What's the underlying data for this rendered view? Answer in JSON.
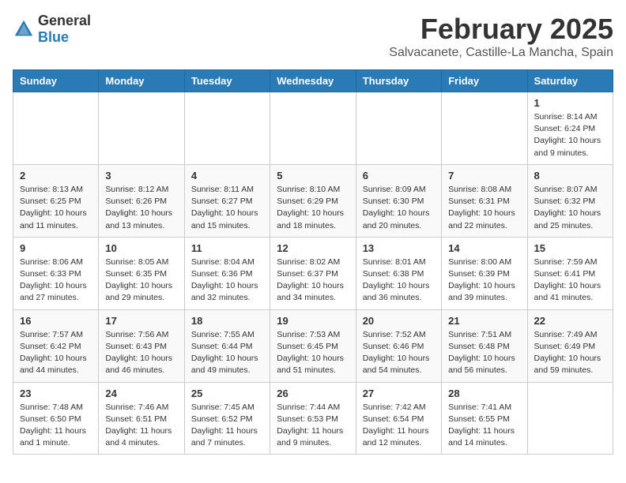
{
  "header": {
    "logo_general": "General",
    "logo_blue": "Blue",
    "month_title": "February 2025",
    "location": "Salvacanete, Castille-La Mancha, Spain"
  },
  "weekdays": [
    "Sunday",
    "Monday",
    "Tuesday",
    "Wednesday",
    "Thursday",
    "Friday",
    "Saturday"
  ],
  "weeks": [
    [
      {
        "day": "",
        "info": ""
      },
      {
        "day": "",
        "info": ""
      },
      {
        "day": "",
        "info": ""
      },
      {
        "day": "",
        "info": ""
      },
      {
        "day": "",
        "info": ""
      },
      {
        "day": "",
        "info": ""
      },
      {
        "day": "1",
        "info": "Sunrise: 8:14 AM\nSunset: 6:24 PM\nDaylight: 10 hours\nand 9 minutes."
      }
    ],
    [
      {
        "day": "2",
        "info": "Sunrise: 8:13 AM\nSunset: 6:25 PM\nDaylight: 10 hours\nand 11 minutes."
      },
      {
        "day": "3",
        "info": "Sunrise: 8:12 AM\nSunset: 6:26 PM\nDaylight: 10 hours\nand 13 minutes."
      },
      {
        "day": "4",
        "info": "Sunrise: 8:11 AM\nSunset: 6:27 PM\nDaylight: 10 hours\nand 15 minutes."
      },
      {
        "day": "5",
        "info": "Sunrise: 8:10 AM\nSunset: 6:29 PM\nDaylight: 10 hours\nand 18 minutes."
      },
      {
        "day": "6",
        "info": "Sunrise: 8:09 AM\nSunset: 6:30 PM\nDaylight: 10 hours\nand 20 minutes."
      },
      {
        "day": "7",
        "info": "Sunrise: 8:08 AM\nSunset: 6:31 PM\nDaylight: 10 hours\nand 22 minutes."
      },
      {
        "day": "8",
        "info": "Sunrise: 8:07 AM\nSunset: 6:32 PM\nDaylight: 10 hours\nand 25 minutes."
      }
    ],
    [
      {
        "day": "9",
        "info": "Sunrise: 8:06 AM\nSunset: 6:33 PM\nDaylight: 10 hours\nand 27 minutes."
      },
      {
        "day": "10",
        "info": "Sunrise: 8:05 AM\nSunset: 6:35 PM\nDaylight: 10 hours\nand 29 minutes."
      },
      {
        "day": "11",
        "info": "Sunrise: 8:04 AM\nSunset: 6:36 PM\nDaylight: 10 hours\nand 32 minutes."
      },
      {
        "day": "12",
        "info": "Sunrise: 8:02 AM\nSunset: 6:37 PM\nDaylight: 10 hours\nand 34 minutes."
      },
      {
        "day": "13",
        "info": "Sunrise: 8:01 AM\nSunset: 6:38 PM\nDaylight: 10 hours\nand 36 minutes."
      },
      {
        "day": "14",
        "info": "Sunrise: 8:00 AM\nSunset: 6:39 PM\nDaylight: 10 hours\nand 39 minutes."
      },
      {
        "day": "15",
        "info": "Sunrise: 7:59 AM\nSunset: 6:41 PM\nDaylight: 10 hours\nand 41 minutes."
      }
    ],
    [
      {
        "day": "16",
        "info": "Sunrise: 7:57 AM\nSunset: 6:42 PM\nDaylight: 10 hours\nand 44 minutes."
      },
      {
        "day": "17",
        "info": "Sunrise: 7:56 AM\nSunset: 6:43 PM\nDaylight: 10 hours\nand 46 minutes."
      },
      {
        "day": "18",
        "info": "Sunrise: 7:55 AM\nSunset: 6:44 PM\nDaylight: 10 hours\nand 49 minutes."
      },
      {
        "day": "19",
        "info": "Sunrise: 7:53 AM\nSunset: 6:45 PM\nDaylight: 10 hours\nand 51 minutes."
      },
      {
        "day": "20",
        "info": "Sunrise: 7:52 AM\nSunset: 6:46 PM\nDaylight: 10 hours\nand 54 minutes."
      },
      {
        "day": "21",
        "info": "Sunrise: 7:51 AM\nSunset: 6:48 PM\nDaylight: 10 hours\nand 56 minutes."
      },
      {
        "day": "22",
        "info": "Sunrise: 7:49 AM\nSunset: 6:49 PM\nDaylight: 10 hours\nand 59 minutes."
      }
    ],
    [
      {
        "day": "23",
        "info": "Sunrise: 7:48 AM\nSunset: 6:50 PM\nDaylight: 11 hours\nand 1 minute."
      },
      {
        "day": "24",
        "info": "Sunrise: 7:46 AM\nSunset: 6:51 PM\nDaylight: 11 hours\nand 4 minutes."
      },
      {
        "day": "25",
        "info": "Sunrise: 7:45 AM\nSunset: 6:52 PM\nDaylight: 11 hours\nand 7 minutes."
      },
      {
        "day": "26",
        "info": "Sunrise: 7:44 AM\nSunset: 6:53 PM\nDaylight: 11 hours\nand 9 minutes."
      },
      {
        "day": "27",
        "info": "Sunrise: 7:42 AM\nSunset: 6:54 PM\nDaylight: 11 hours\nand 12 minutes."
      },
      {
        "day": "28",
        "info": "Sunrise: 7:41 AM\nSunset: 6:55 PM\nDaylight: 11 hours\nand 14 minutes."
      },
      {
        "day": "",
        "info": ""
      }
    ]
  ]
}
